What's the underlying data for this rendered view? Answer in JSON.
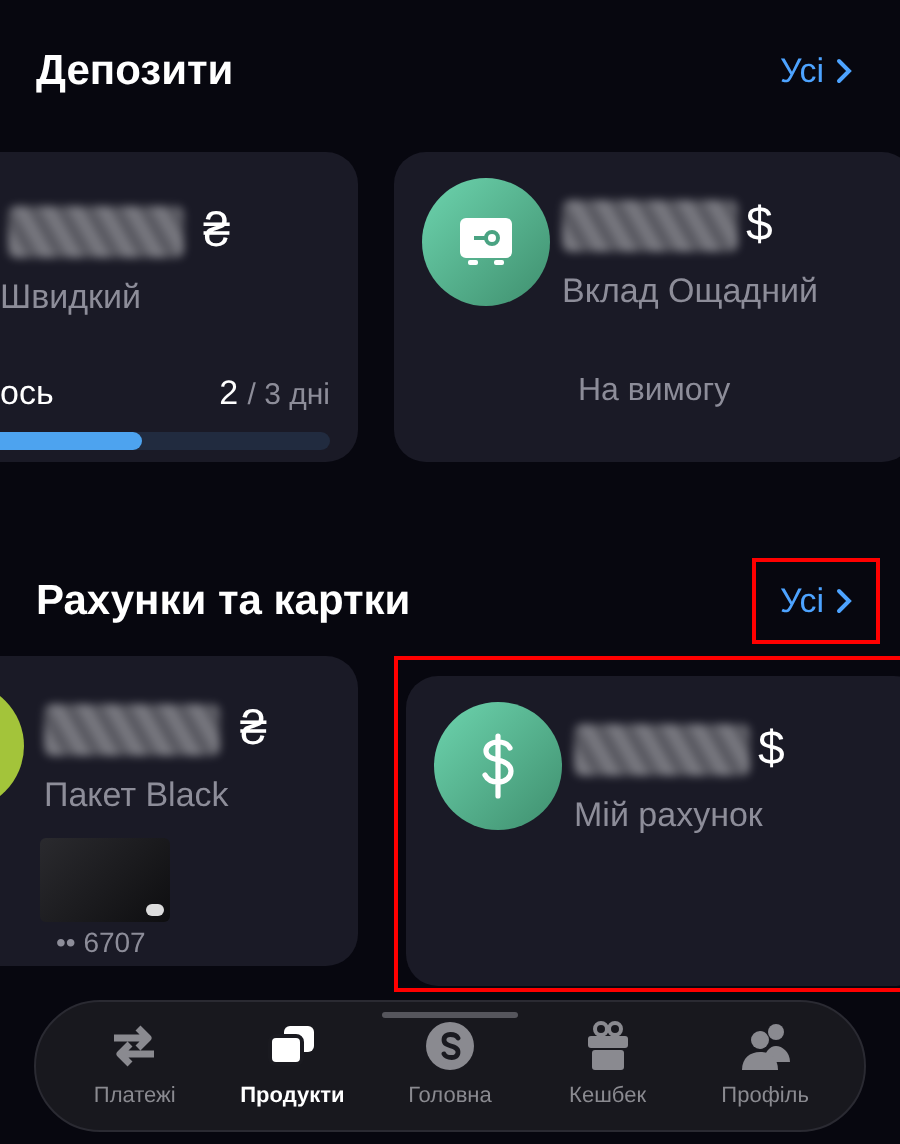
{
  "sections": [
    {
      "title": "Депозити",
      "link": "Усі",
      "highlighted": false,
      "cards": [
        {
          "kind": "progress",
          "currency": "₴",
          "name": "Швидкий",
          "progress_label": "ось",
          "progress_value": "2",
          "progress_total": "/ 3 дні",
          "level": 0.6
        },
        {
          "kind": "savings",
          "currency": "$",
          "name": "Вклад Ощадний",
          "term": "На вимогу",
          "highlighted": false
        }
      ]
    },
    {
      "title": "Рахунки та картки",
      "link": "Усі",
      "highlighted": true,
      "cards": [
        {
          "kind": "card",
          "currency": "₴",
          "name": "Пакет Black",
          "card_number": "•• 6707"
        },
        {
          "kind": "currency",
          "currency": "$",
          "name": "Мій рахунок",
          "highlighted": true
        }
      ]
    }
  ],
  "nav": [
    {
      "label": "Платежі",
      "selected": false
    },
    {
      "label": "Продукти",
      "selected": true
    },
    {
      "label": "Головна",
      "selected": false
    },
    {
      "label": "Кешбек",
      "selected": false
    },
    {
      "label": "Профіль",
      "selected": false
    }
  ]
}
